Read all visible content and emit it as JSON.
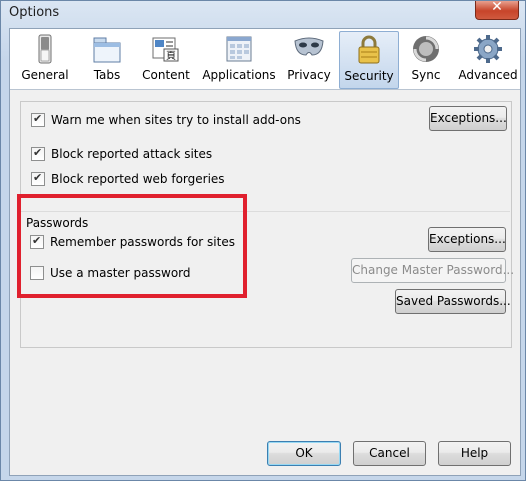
{
  "window": {
    "title": "Options",
    "close_glyph": "✕"
  },
  "toolbar": {
    "panes": [
      {
        "label": "General",
        "icon": "general-switch-icon"
      },
      {
        "label": "Tabs",
        "icon": "tabs-icon"
      },
      {
        "label": "Content",
        "icon": "content-icon"
      },
      {
        "label": "Applications",
        "icon": "applications-icon"
      },
      {
        "label": "Privacy",
        "icon": "privacy-mask-icon"
      },
      {
        "label": "Security",
        "icon": "security-lock-icon",
        "selected": true
      },
      {
        "label": "Sync",
        "icon": "sync-icon"
      },
      {
        "label": "Advanced",
        "icon": "advanced-gear-icon"
      }
    ]
  },
  "security": {
    "addons_warning": {
      "label": "Warn me when sites try to install add-ons",
      "checked": true
    },
    "exceptions_label_1": "Exceptions...",
    "block_attack": {
      "label": "Block reported attack sites",
      "checked": true
    },
    "block_forgeries": {
      "label": "Block reported web forgeries",
      "checked": true
    },
    "passwords_heading": "Passwords",
    "remember_passwords": {
      "label": "Remember passwords for sites",
      "checked": true
    },
    "exceptions_label_2": "Exceptions...",
    "master_password": {
      "label": "Use a master password",
      "checked": false
    },
    "change_master_label": "Change Master Password...",
    "saved_passwords_label": "Saved Passwords..."
  },
  "footer": {
    "ok_label": "OK",
    "cancel_label": "Cancel",
    "help_label": "Help"
  },
  "colors": {
    "highlight": "#e0202e",
    "selected_tab": "#c3d6ec"
  }
}
